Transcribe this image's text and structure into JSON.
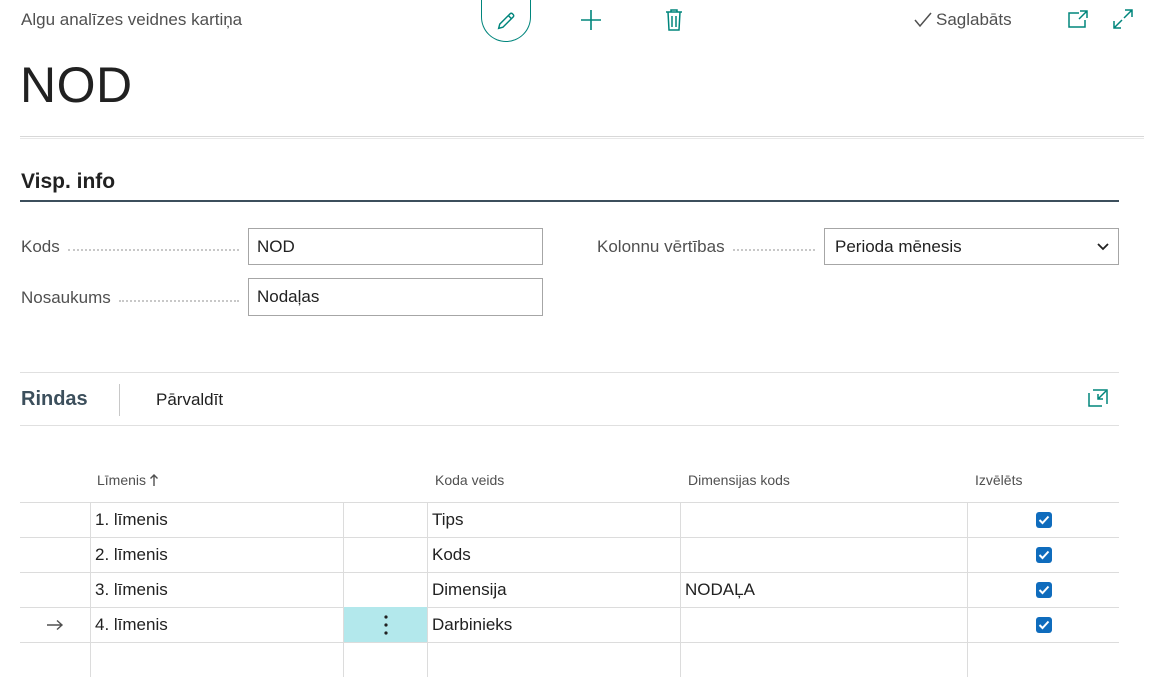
{
  "header": {
    "caption": "Algu analīzes veidnes kartiņa",
    "saved_label": "Saglabāts",
    "record_title": "NOD"
  },
  "general": {
    "section_title": "Visp. info",
    "code_label": "Kods",
    "code_value": "NOD",
    "name_label": "Nosaukums",
    "name_value": "Nodaļas",
    "column_values_label": "Kolonnu vērtības",
    "column_values_value": "Perioda mēnesis"
  },
  "lines": {
    "title": "Rindas",
    "manage_label": "Pārvaldīt",
    "columns": {
      "level": "Līmenis",
      "code_type": "Koda veids",
      "dimension_code": "Dimensijas kods",
      "selected": "Izvēlēts"
    },
    "rows": [
      {
        "level": "1. līmenis",
        "code_type": "Tips",
        "dimension_code": "",
        "selected": true
      },
      {
        "level": "2. līmenis",
        "code_type": "Kods",
        "dimension_code": "",
        "selected": true
      },
      {
        "level": "3. līmenis",
        "code_type": "Dimensija",
        "dimension_code": "NODAĻA",
        "selected": true
      },
      {
        "level": "4. līmenis",
        "code_type": "Darbinieks",
        "dimension_code": "",
        "selected": true
      }
    ]
  },
  "colors": {
    "accent": "#00857c",
    "checkbox": "#0f6cbd",
    "active_cell": "#b3e8ec"
  },
  "icons": [
    "edit-icon",
    "add-icon",
    "delete-icon",
    "checkmark-icon",
    "open-new-window-icon",
    "expand-icon",
    "chevron-down-icon",
    "sort-up-icon",
    "arrow-right-icon",
    "more-vertical-icon"
  ]
}
